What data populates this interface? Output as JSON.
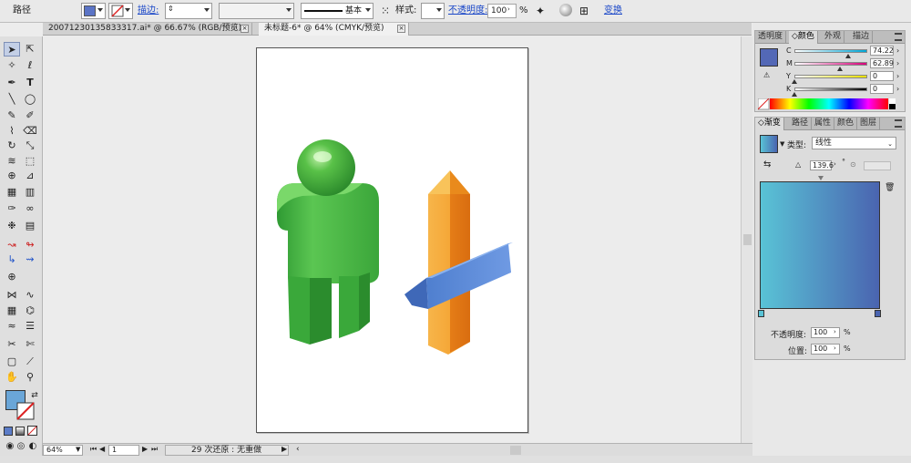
{
  "control_bar": {
    "object_type": "路径",
    "stroke_label": "描边:",
    "stroke_profile": "基本",
    "style_label": "样式:",
    "opacity_label": "不透明度:",
    "opacity_value": "100",
    "opacity_unit": "%",
    "transform_label": "变换",
    "fill_color": "#5b74c6",
    "stroke_color": "none"
  },
  "document_tabs": [
    {
      "label": "20071230135833317.ai* @ 66.67% (RGB/预览)",
      "active": false
    },
    {
      "label": "未标题-6* @ 64% (CMYK/预览)",
      "active": true
    }
  ],
  "tools": {
    "fill_color": "#6aa6d8",
    "stroke_color": "none"
  },
  "artwork": {
    "figure_color": "#46b33f",
    "arrow_post_color": "#f09a2a",
    "arrow_sign_color": "#5e8ad8"
  },
  "color_panel": {
    "tabs": [
      "透明度",
      "颜色",
      "外观",
      "描边"
    ],
    "active_tab": "颜色",
    "channels": [
      {
        "label": "C",
        "value": "74.22",
        "fraction": 0.74
      },
      {
        "label": "M",
        "value": "62.89",
        "fraction": 0.63
      },
      {
        "label": "Y",
        "value": "0",
        "fraction": 0.0
      },
      {
        "label": "K",
        "value": "0",
        "fraction": 0.0
      }
    ],
    "swatch_color": "#5368b6"
  },
  "gradient_panel": {
    "tabs": [
      "渐变",
      "路径",
      "属性",
      "颜色",
      "图层"
    ],
    "active_tab": "渐变",
    "type_label": "类型:",
    "type_value": "线性",
    "angle_value": "139.6",
    "angle_unit": "°",
    "start_color": "#59c3d6",
    "end_color": "#4a64b0",
    "opacity_label": "不透明度:",
    "opacity_value": "100",
    "location_label": "位置:",
    "location_value": "100",
    "percent_unit": "%"
  },
  "status_bar": {
    "zoom": "64%",
    "artboard_number": "1",
    "undo_status": "29 次还原 : 无重做"
  }
}
